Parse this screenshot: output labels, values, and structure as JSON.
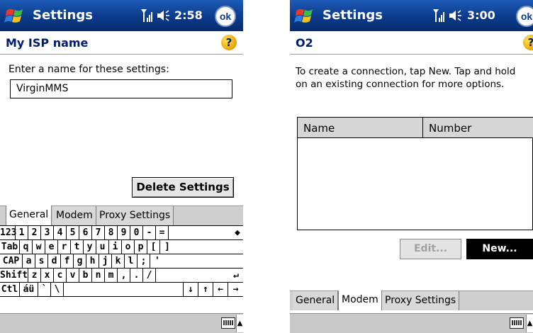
{
  "left": {
    "titlebar": {
      "title": "Settings",
      "time": "2:58",
      "ok_label": "ok"
    },
    "header": {
      "title": "My ISP name",
      "help_glyph": "?"
    },
    "prompt": "Enter a name for these settings:",
    "name_value": "VirginMMS",
    "delete_label": "Delete Settings",
    "tabs": [
      {
        "label": "General"
      },
      {
        "label": "Modem"
      },
      {
        "label": "Proxy Settings"
      }
    ],
    "keyboard": {
      "rows": [
        [
          "123",
          "1",
          "2",
          "3",
          "4",
          "5",
          "6",
          "7",
          "8",
          "9",
          "0",
          "-",
          "=",
          "◆"
        ],
        [
          "Tab",
          "q",
          "w",
          "e",
          "r",
          "t",
          "y",
          "u",
          "i",
          "o",
          "p",
          "[",
          "]"
        ],
        [
          "CAP",
          "a",
          "s",
          "d",
          "f",
          "g",
          "h",
          "j",
          "k",
          "l",
          ";",
          "'"
        ],
        [
          "Shift",
          "z",
          "x",
          "c",
          "v",
          "b",
          "n",
          "m",
          ",",
          ".",
          "/",
          "↵"
        ],
        [
          "Ctl",
          "áü",
          "`",
          "\\",
          "",
          "↓",
          "↑",
          "←",
          "→"
        ]
      ]
    }
  },
  "right": {
    "titlebar": {
      "title": "Settings",
      "time": "3:00",
      "ok_label": "ok"
    },
    "header": {
      "title": "O2",
      "help_glyph": "?"
    },
    "description": "To create a connection, tap New. Tap and hold on an existing connection for more options.",
    "table": {
      "col_name": "Name",
      "col_number": "Number"
    },
    "edit_label": "Edit...",
    "new_label": "New...",
    "tabs": [
      {
        "label": "General"
      },
      {
        "label": "Modem"
      },
      {
        "label": "Proxy Settings"
      }
    ]
  },
  "icons": {
    "start": "windows-flag-icon",
    "signal": "signal-antenna-icon",
    "speaker": "speaker-icon",
    "help": "help-icon",
    "keyboard": "keyboard-icon",
    "caret": "caret-up-icon"
  },
  "colors": {
    "titlebar": "#0b3a8a",
    "header_text": "#001c6c",
    "help": "#e8a300"
  }
}
